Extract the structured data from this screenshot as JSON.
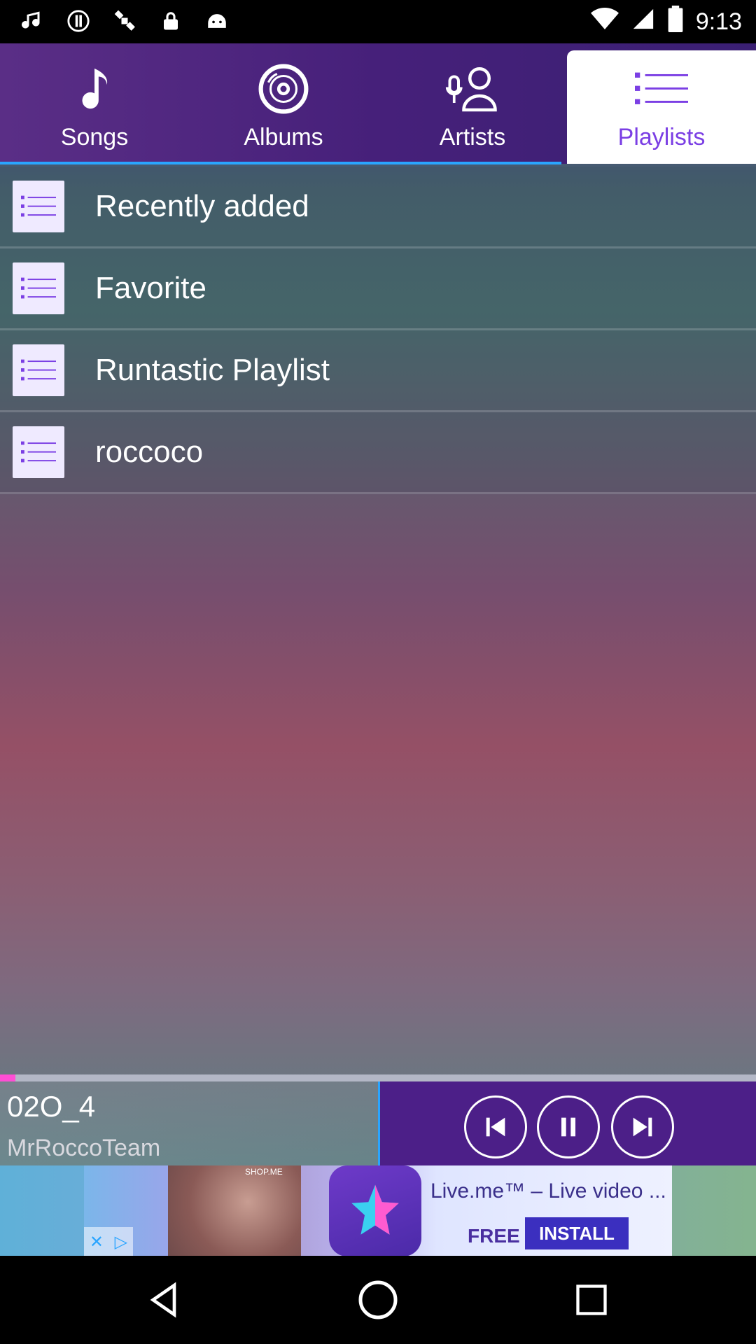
{
  "status_bar": {
    "time": "9:13",
    "left_icons": [
      "music-note-icon",
      "alert-icon",
      "satellite-icon",
      "lock-icon",
      "android-icon"
    ],
    "right_icons": [
      "wifi-icon",
      "signal-icon",
      "battery-icon"
    ]
  },
  "tabs": [
    {
      "label": "Songs",
      "icon": "music-note-icon",
      "active": false
    },
    {
      "label": "Albums",
      "icon": "disc-icon",
      "active": false
    },
    {
      "label": "Artists",
      "icon": "microphone-person-icon",
      "active": false
    },
    {
      "label": "Playlists",
      "icon": "list-icon",
      "active": true
    }
  ],
  "playlists": [
    {
      "title": "Recently added"
    },
    {
      "title": "Favorite"
    },
    {
      "title": "Runtastic Playlist"
    },
    {
      "title": "roccoco"
    }
  ],
  "now_playing": {
    "song": "02O_4",
    "artist": "MrRoccoTeam",
    "progress_fraction": 0.02
  },
  "controls": {
    "prev": "skip-previous-icon",
    "pause": "pause-icon",
    "next": "skip-next-icon"
  },
  "ad": {
    "title": "Live.me™ – Live video ...",
    "free_label": "FREE",
    "install_label": "INSTALL",
    "small_text": "SHOP.ME"
  },
  "nav": [
    "back-icon",
    "home-icon",
    "recents-icon"
  ],
  "colors": {
    "accent": "#7b3fe4",
    "tab_indicator": "#2aa5ff",
    "controls_bg": "#4c1f88",
    "progress_fill": "#ff4ed4"
  }
}
